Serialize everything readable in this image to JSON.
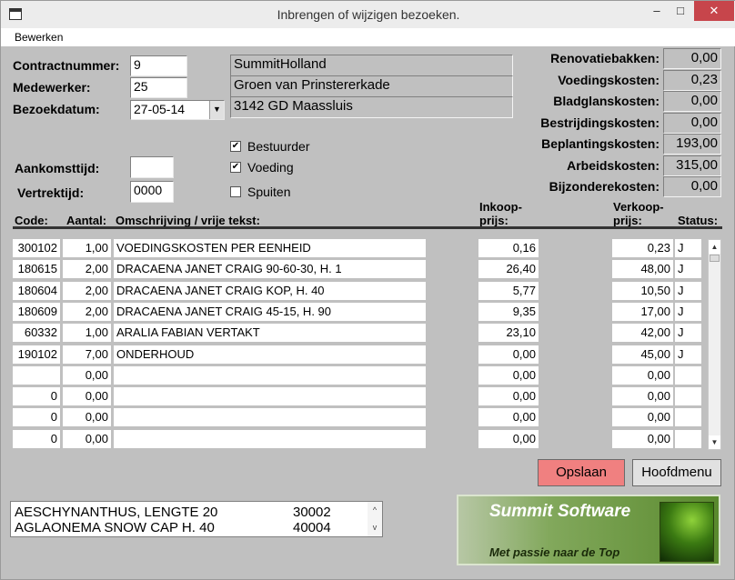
{
  "window": {
    "title": "Inbrengen of wijzigen bezoeken.",
    "minimize": "–",
    "maximize": "□",
    "close": "✕"
  },
  "menu": {
    "bewerken": "Bewerken"
  },
  "form": {
    "contract_label": "Contractnummer:",
    "contract_value": "9",
    "medewerker_label": "Medewerker:",
    "medewerker_value": "25",
    "datum_label": "Bezoekdatum:",
    "datum_value": "27-05-14",
    "aankomst_label": "Aankomsttijd:",
    "aankomst_value": "",
    "vertrek_label": "Vertrektijd:",
    "vertrek_value": "0000"
  },
  "customer": {
    "name": "SummitHolland",
    "street": "Groen van Prinstererkade",
    "city": "3142 GD  Maassluis"
  },
  "options": [
    {
      "label": "Bestuurder",
      "checked": true
    },
    {
      "label": "Voeding",
      "checked": true
    },
    {
      "label": "Spuiten",
      "checked": false
    }
  ],
  "costs": [
    {
      "label": "Renovatiebakken:",
      "value": "0,00"
    },
    {
      "label": "Voedingskosten:",
      "value": "0,23"
    },
    {
      "label": "Bladglanskosten:",
      "value": "0,00"
    },
    {
      "label": "Bestrijdingskosten:",
      "value": "0,00"
    },
    {
      "label": "Beplantingskosten:",
      "value": "193,00"
    },
    {
      "label": "Arbeidskosten:",
      "value": "315,00"
    },
    {
      "label": "Bijzonderekosten:",
      "value": "0,00"
    }
  ],
  "table": {
    "headers": {
      "code": "Code:",
      "aantal": "Aantal:",
      "omschrijving": "Omschrijving / vrije tekst:",
      "inkoop": "Inkoop-\nprijs:",
      "verkoop": "Verkoop-\nprijs:",
      "status": "Status:"
    },
    "rows": [
      {
        "code": "300102",
        "aantal": "1,00",
        "omschrijving": "VOEDINGSKOSTEN PER EENHEID",
        "inkoop": "0,16",
        "verkoop": "0,23",
        "status": "J"
      },
      {
        "code": "180615",
        "aantal": "2,00",
        "omschrijving": "DRACAENA JANET CRAIG 90-60-30, H. 1",
        "inkoop": "26,40",
        "verkoop": "48,00",
        "status": "J"
      },
      {
        "code": "180604",
        "aantal": "2,00",
        "omschrijving": "DRACAENA JANET CRAIG KOP, H. 40",
        "inkoop": "5,77",
        "verkoop": "10,50",
        "status": "J"
      },
      {
        "code": "180609",
        "aantal": "2,00",
        "omschrijving": "DRACAENA JANET CRAIG 45-15, H. 90",
        "inkoop": "9,35",
        "verkoop": "17,00",
        "status": "J"
      },
      {
        "code": "60332",
        "aantal": "1,00",
        "omschrijving": "ARALIA FABIAN VERTAKT",
        "inkoop": "23,10",
        "verkoop": "42,00",
        "status": "J"
      },
      {
        "code": "190102",
        "aantal": "7,00",
        "omschrijving": "ONDERHOUD",
        "inkoop": "0,00",
        "verkoop": "45,00",
        "status": "J"
      },
      {
        "code": "",
        "aantal": "0,00",
        "omschrijving": "",
        "inkoop": "0,00",
        "verkoop": "0,00",
        "status": ""
      },
      {
        "code": "0",
        "aantal": "0,00",
        "omschrijving": "",
        "inkoop": "0,00",
        "verkoop": "0,00",
        "status": ""
      },
      {
        "code": "0",
        "aantal": "0,00",
        "omschrijving": "",
        "inkoop": "0,00",
        "verkoop": "0,00",
        "status": ""
      },
      {
        "code": "0",
        "aantal": "0,00",
        "omschrijving": "",
        "inkoop": "0,00",
        "verkoop": "0,00",
        "status": ""
      }
    ]
  },
  "buttons": {
    "opslaan": "Opslaan",
    "hoofdmenu": "Hoofdmenu"
  },
  "lookup_list": [
    {
      "name": "AESCHYNANTHUS, LENGTE 20",
      "code": "30002"
    },
    {
      "name": "AGLAONEMA SNOW CAP H. 40",
      "code": "40004"
    }
  ],
  "logo": {
    "title": "Summit Software",
    "subtitle": "Met passie naar de Top"
  },
  "colors": {
    "opslaan_bg": "#f08080",
    "background": "#c0c0c0"
  }
}
